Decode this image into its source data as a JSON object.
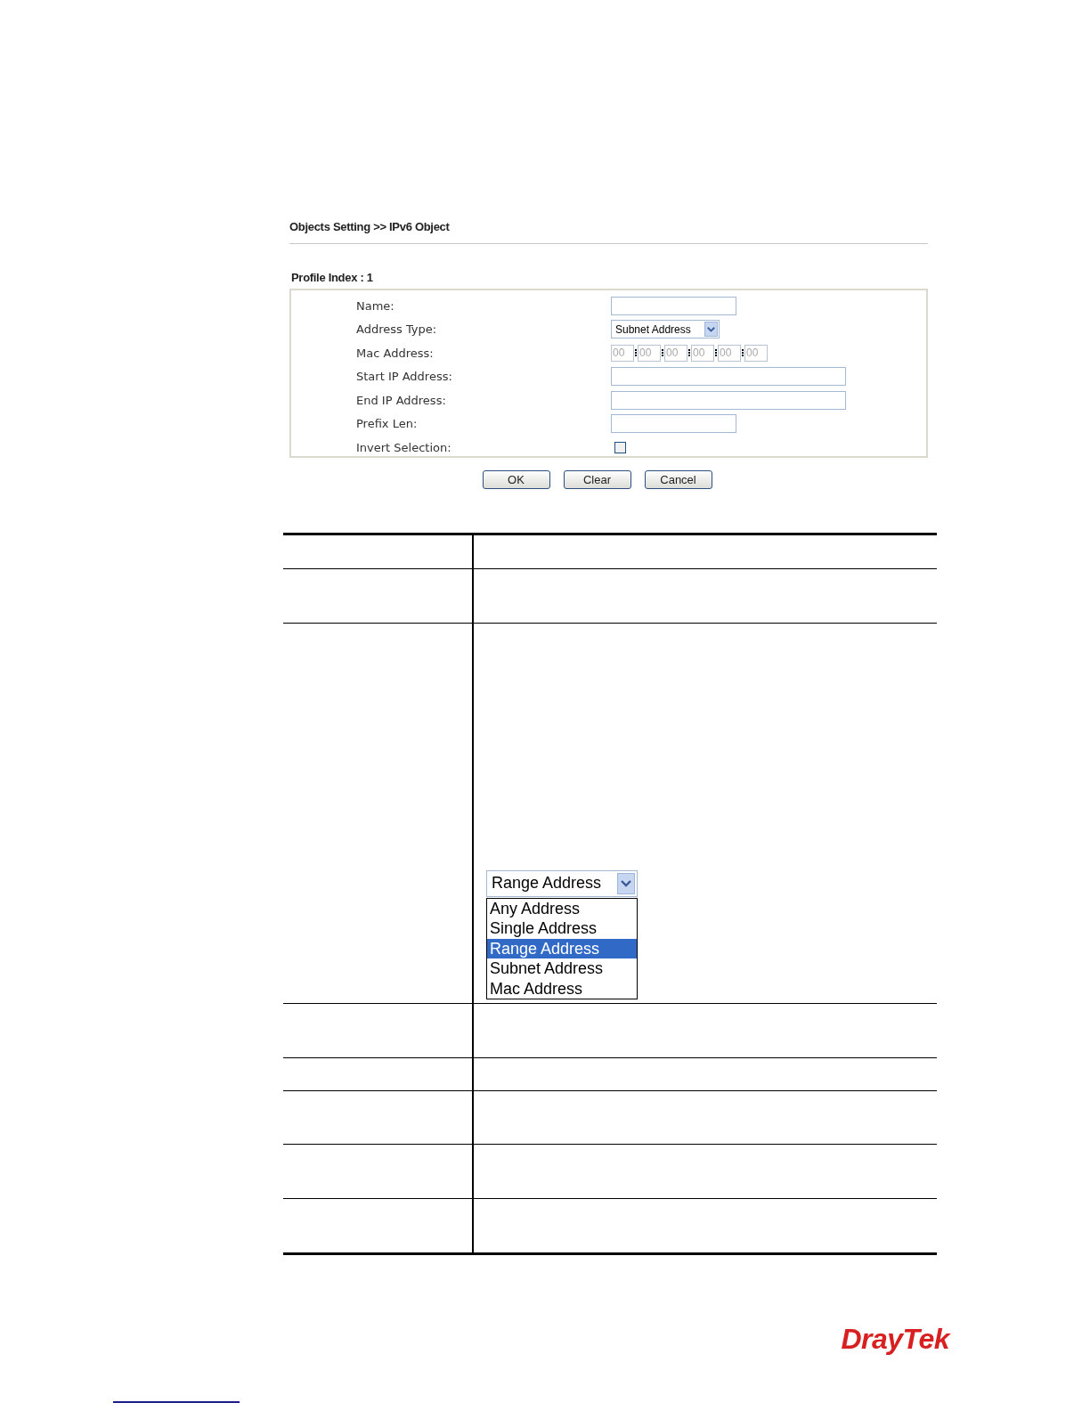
{
  "breadcrumb": "Objects Setting >> IPv6 Object",
  "profile_index": "Profile Index : 1",
  "fields": [
    {
      "kind": "text",
      "label": "Name:"
    },
    {
      "kind": "select",
      "label": "Address Type:",
      "value": "Subnet Address"
    },
    {
      "kind": "mac",
      "label": "Mac Address:",
      "octets": [
        "00",
        "00",
        "00",
        "00",
        "00",
        "00"
      ],
      "disabled": true
    },
    {
      "kind": "wide",
      "label": "Start IP Address:"
    },
    {
      "kind": "wide",
      "label": "End IP Address:"
    },
    {
      "kind": "text",
      "label": "Prefix Len:"
    },
    {
      "kind": "checkbox",
      "label": "Invert Selection:",
      "checked": false
    }
  ],
  "buttons": [
    "OK",
    "Clear",
    "Cancel"
  ],
  "dropdown": {
    "value": "Range Address",
    "options": [
      {
        "label": "Any Address",
        "selected": false
      },
      {
        "label": "Single Address",
        "selected": false
      },
      {
        "label": "Range Address",
        "selected": true
      },
      {
        "label": "Subnet Address",
        "selected": false
      },
      {
        "label": "Mac Address",
        "selected": false
      }
    ]
  },
  "logo": "DrayTek"
}
